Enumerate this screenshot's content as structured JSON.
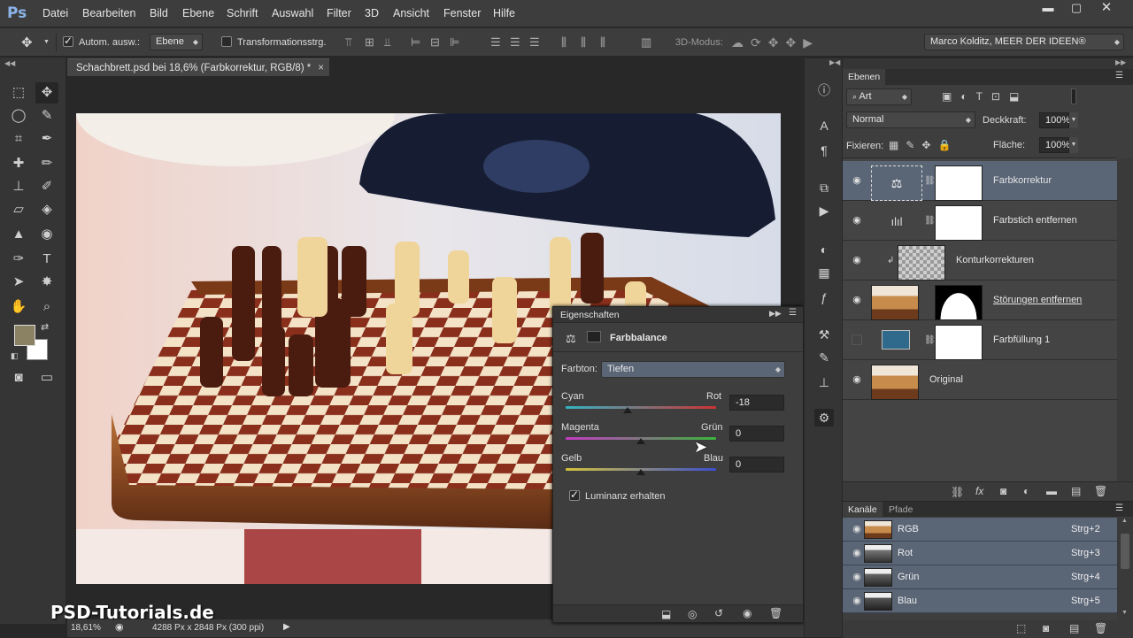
{
  "app": {
    "logo": "Ps"
  },
  "menu": [
    "Datei",
    "Bearbeiten",
    "Bild",
    "Ebene",
    "Schrift",
    "Auswahl",
    "Filter",
    "3D",
    "Ansicht",
    "Fenster",
    "Hilfe"
  ],
  "options": {
    "auto_select_label": "Autom. ausw.:",
    "auto_select_value": "Ebene",
    "transform_label": "Transformationsstrg.",
    "mode3d_label": "3D-Modus:",
    "workspace": "Marco Kolditz, MEER DER IDEEN®"
  },
  "document": {
    "tab_title": "Schachbrett.psd bei 18,6% (Farbkorrektur, RGB/8) *",
    "zoom": "18,61%",
    "doc_info": "4288 Px x 2848 Px (300 ppi)",
    "watermark": "PSD-Tutorials.de"
  },
  "properties": {
    "title": "Eigenschaften",
    "adjustment": "Farbbalance",
    "tone_label": "Farbton:",
    "tone_value": "Tiefen",
    "sliders": [
      {
        "left": "Cyan",
        "right": "Rot",
        "value": "-18",
        "level": -18
      },
      {
        "left": "Magenta",
        "right": "Grün",
        "value": "0",
        "level": 0
      },
      {
        "left": "Gelb",
        "right": "Blau",
        "value": "0",
        "level": 0
      }
    ],
    "preserve_luminosity": "Luminanz erhalten"
  },
  "layers": {
    "tab": "Ebenen",
    "filter_kind": "Art",
    "blend_mode": "Normal",
    "opacity_label": "Deckkraft:",
    "opacity": "100%",
    "lock_label": "Fixieren:",
    "fill_label": "Fläche:",
    "fill": "100%",
    "items": [
      {
        "name": "Farbkorrektur"
      },
      {
        "name": "Farbstich entfernen"
      },
      {
        "name": "Konturkorrekturen"
      },
      {
        "name": "Störungen entfernen"
      },
      {
        "name": "Farbfüllung 1"
      },
      {
        "name": "Original"
      }
    ]
  },
  "channels": {
    "tabs": [
      "Kanäle",
      "Pfade"
    ],
    "items": [
      {
        "name": "RGB",
        "shortcut": "Strg+2"
      },
      {
        "name": "Rot",
        "shortcut": "Strg+3"
      },
      {
        "name": "Grün",
        "shortcut": "Strg+4"
      },
      {
        "name": "Blau",
        "shortcut": "Strg+5"
      }
    ]
  },
  "colors": {
    "foreground": "#8a8263",
    "background": "#ffffff",
    "fill_layer": "#2f6a8c",
    "selection": "#5a6576"
  }
}
